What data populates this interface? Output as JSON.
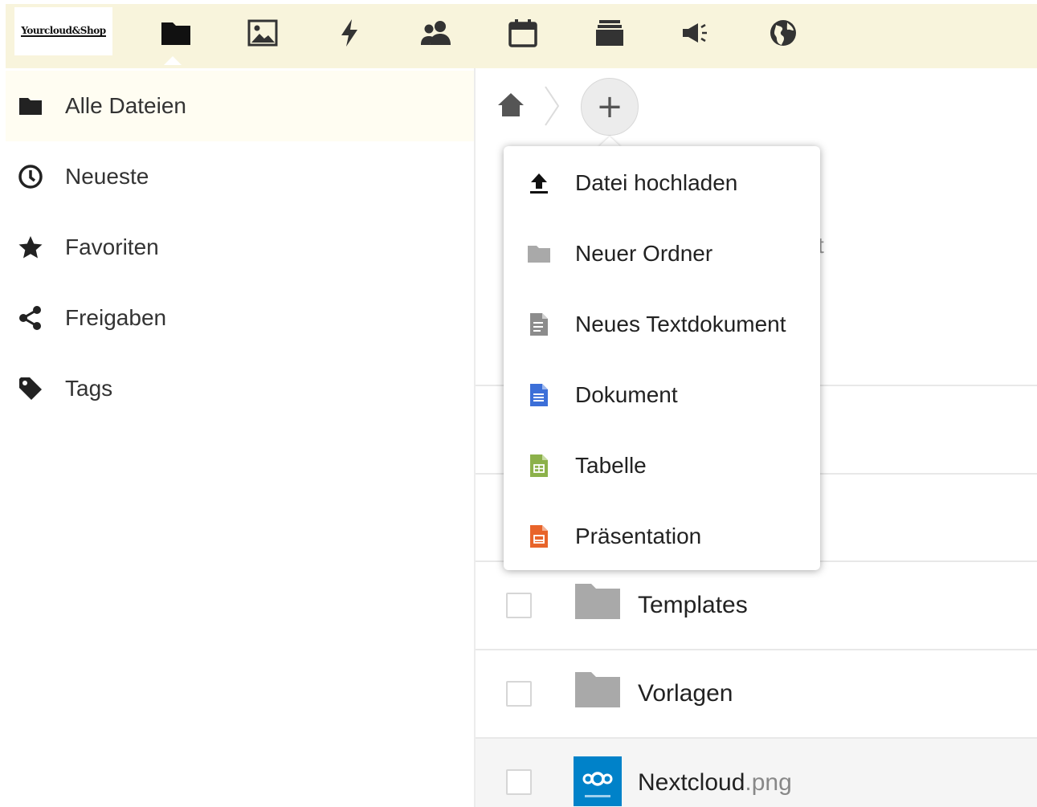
{
  "header": {
    "logo_text": "Yourcloud&Shop",
    "apps": [
      {
        "name": "files",
        "icon": "folder-icon",
        "active": true
      },
      {
        "name": "photos",
        "icon": "image-icon"
      },
      {
        "name": "activity",
        "icon": "lightning-icon"
      },
      {
        "name": "contacts",
        "icon": "contacts-icon"
      },
      {
        "name": "calendar",
        "icon": "calendar-icon"
      },
      {
        "name": "deck",
        "icon": "stack-icon"
      },
      {
        "name": "announcements",
        "icon": "megaphone-icon"
      },
      {
        "name": "web",
        "icon": "globe-icon"
      }
    ]
  },
  "sidebar": {
    "items": [
      {
        "label": "Alle Dateien",
        "icon": "folder-icon",
        "active": true
      },
      {
        "label": "Neueste",
        "icon": "clock-icon"
      },
      {
        "label": "Favoriten",
        "icon": "star-icon"
      },
      {
        "label": "Freigaben",
        "icon": "share-icon"
      },
      {
        "label": "Tags",
        "icon": "tag-icon"
      }
    ]
  },
  "breadcrumb": {
    "home_icon": "home-icon",
    "new_button_label": "+"
  },
  "new_menu": {
    "items": [
      {
        "label": "Datei hochladen",
        "icon": "upload-icon"
      },
      {
        "label": "Neuer Ordner",
        "icon": "folder-icon"
      },
      {
        "label": "Neues Textdokument",
        "icon": "text-file-icon"
      },
      {
        "label": "Dokument",
        "icon": "document-icon"
      },
      {
        "label": "Tabelle",
        "icon": "spreadsheet-icon"
      },
      {
        "label": "Präsentation",
        "icon": "presentation-icon"
      }
    ]
  },
  "partial_text": "t",
  "files": [
    {
      "name": "Templates",
      "ext": "",
      "type": "folder"
    },
    {
      "name": "Vorlagen",
      "ext": "",
      "type": "folder"
    },
    {
      "name": "Nextcloud",
      "ext": ".png",
      "type": "image"
    }
  ],
  "colors": {
    "header_bg": "#f8f4dc",
    "document_blue": "#3c6fd8",
    "spreadsheet_green": "#8cb14a",
    "presentation_orange": "#e8642a",
    "nextcloud_blue": "#0082c9"
  }
}
